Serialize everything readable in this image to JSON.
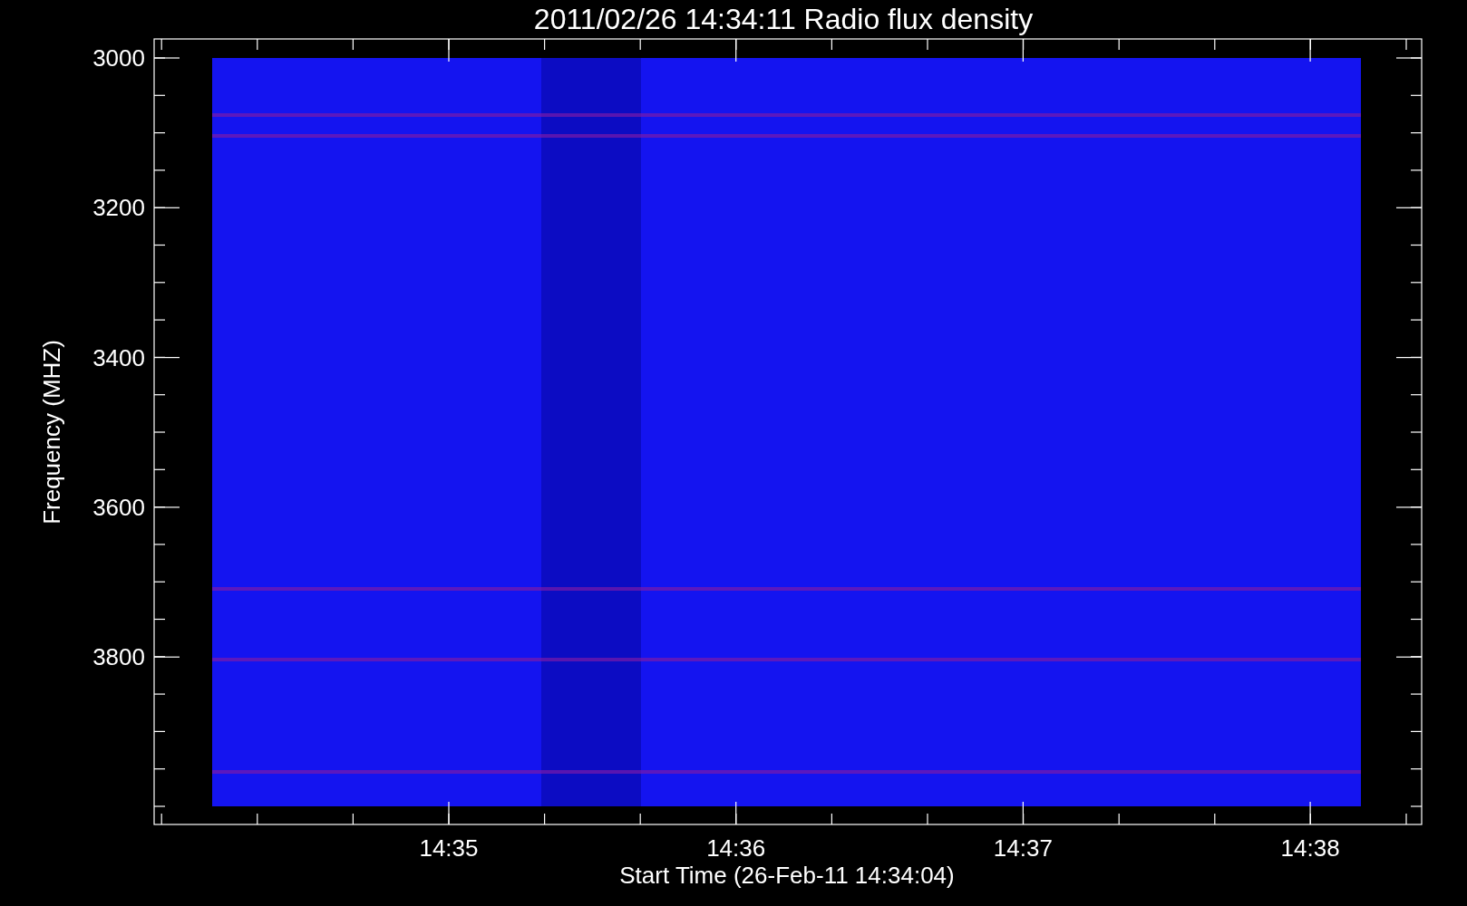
{
  "title": "2011/02/26 14:34:11 Radio flux density",
  "y_axis": {
    "label": "Frequency (MHZ)",
    "ticks": [
      "3000",
      "3200",
      "3400",
      "3600",
      "3800"
    ]
  },
  "x_axis": {
    "label": "Start Time (26-Feb-11 14:34:04)",
    "ticks": [
      "14:35",
      "14:36",
      "14:37",
      "14:38"
    ]
  }
}
